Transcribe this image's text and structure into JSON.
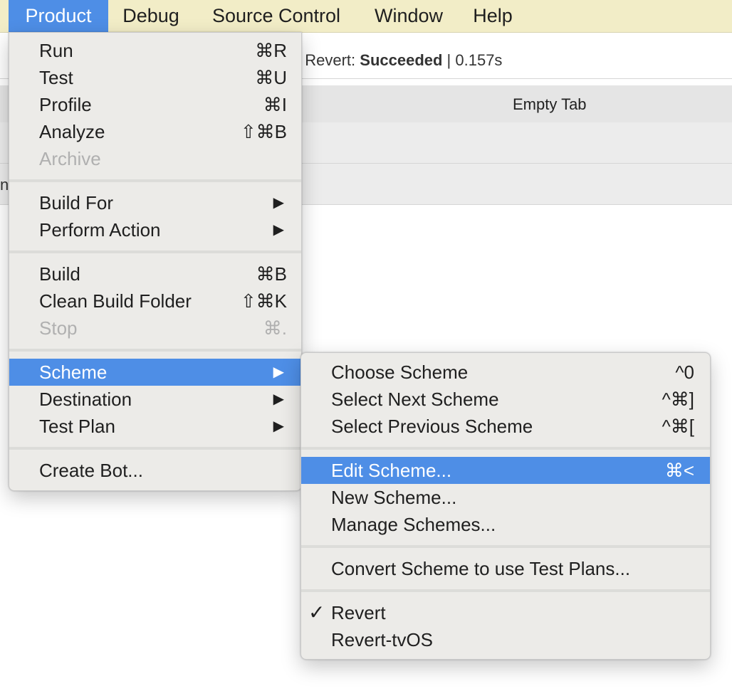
{
  "menubar": {
    "items": [
      "Product",
      "Debug",
      "Source Control",
      "Window",
      "Help"
    ]
  },
  "activity": {
    "prefix": "ld Revert: ",
    "status": "Succeeded",
    "suffix": " | 0.157s"
  },
  "tabs": {
    "active_label": "Empty Tab"
  },
  "navbar": {
    "fragment": "n"
  },
  "product_menu": {
    "items": [
      {
        "label": "Run",
        "shortcut": "⌘R"
      },
      {
        "label": "Test",
        "shortcut": "⌘U"
      },
      {
        "label": "Profile",
        "shortcut": "⌘I"
      },
      {
        "label": "Analyze",
        "shortcut": "⇧⌘B"
      },
      {
        "label": "Archive",
        "shortcut": ""
      },
      {
        "label": "Build For",
        "shortcut": ""
      },
      {
        "label": "Perform Action",
        "shortcut": ""
      },
      {
        "label": "Build",
        "shortcut": "⌘B"
      },
      {
        "label": "Clean Build Folder",
        "shortcut": "⇧⌘K"
      },
      {
        "label": "Stop",
        "shortcut": "⌘."
      },
      {
        "label": "Scheme",
        "shortcut": ""
      },
      {
        "label": "Destination",
        "shortcut": ""
      },
      {
        "label": "Test Plan",
        "shortcut": ""
      },
      {
        "label": "Create Bot...",
        "shortcut": ""
      }
    ]
  },
  "scheme_menu": {
    "items": [
      {
        "label": "Choose Scheme",
        "shortcut": "^0"
      },
      {
        "label": "Select Next Scheme",
        "shortcut": "^⌘]"
      },
      {
        "label": "Select Previous Scheme",
        "shortcut": "^⌘["
      },
      {
        "label": "Edit Scheme...",
        "shortcut": "⌘<"
      },
      {
        "label": "New Scheme...",
        "shortcut": ""
      },
      {
        "label": "Manage Schemes...",
        "shortcut": ""
      },
      {
        "label": "Convert Scheme to use Test Plans...",
        "shortcut": ""
      },
      {
        "label": "Revert",
        "shortcut": ""
      },
      {
        "label": "Revert-tvOS",
        "shortcut": ""
      }
    ]
  },
  "icons": {
    "submenu_arrow": "▶",
    "checkmark": "✓"
  },
  "colors": {
    "menubar_bg": "#f2edc7",
    "highlight": "#4e8ee6",
    "menu_bg": "#ecebe8",
    "disabled_text": "#b0b0b0"
  }
}
